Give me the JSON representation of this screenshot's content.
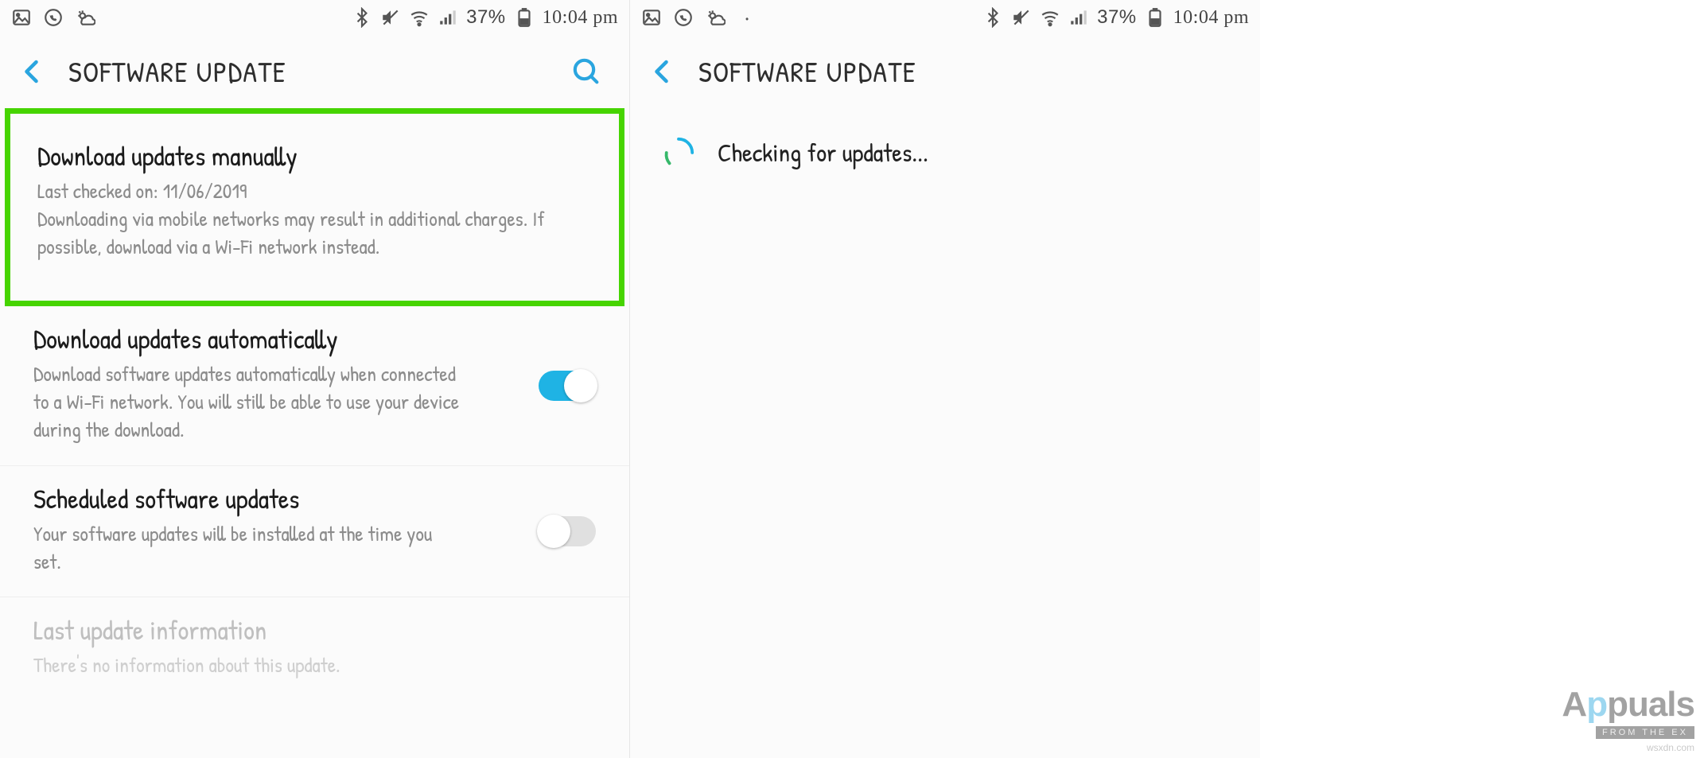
{
  "status": {
    "battery_pct": "37%",
    "time": "10:04 pm"
  },
  "left": {
    "title": "SOFTWARE UPDATE",
    "rows": {
      "manual": {
        "title": "Download updates manually",
        "sub_line1": "Last checked on: 11/06/2019",
        "sub_line2": "Downloading via mobile networks may result in additional charges. If possible, download via a Wi-Fi network instead."
      },
      "auto": {
        "title": "Download updates automatically",
        "sub": "Download software updates automatically when connected to a Wi-Fi network. You will still be able to use your device during the download.",
        "enabled": true
      },
      "scheduled": {
        "title": "Scheduled software updates",
        "sub": "Your software updates will be installed at the time you set.",
        "enabled": false
      },
      "last_info": {
        "title": "Last update information",
        "sub": "There's no information about this update."
      }
    }
  },
  "right": {
    "title": "SOFTWARE UPDATE",
    "checking": "Checking for updates..."
  },
  "watermark": {
    "brand_a": "A",
    "brand_p": "p",
    "brand_rest": "puals",
    "tag": "FROM THE EX",
    "site": "wsxdn.com"
  }
}
